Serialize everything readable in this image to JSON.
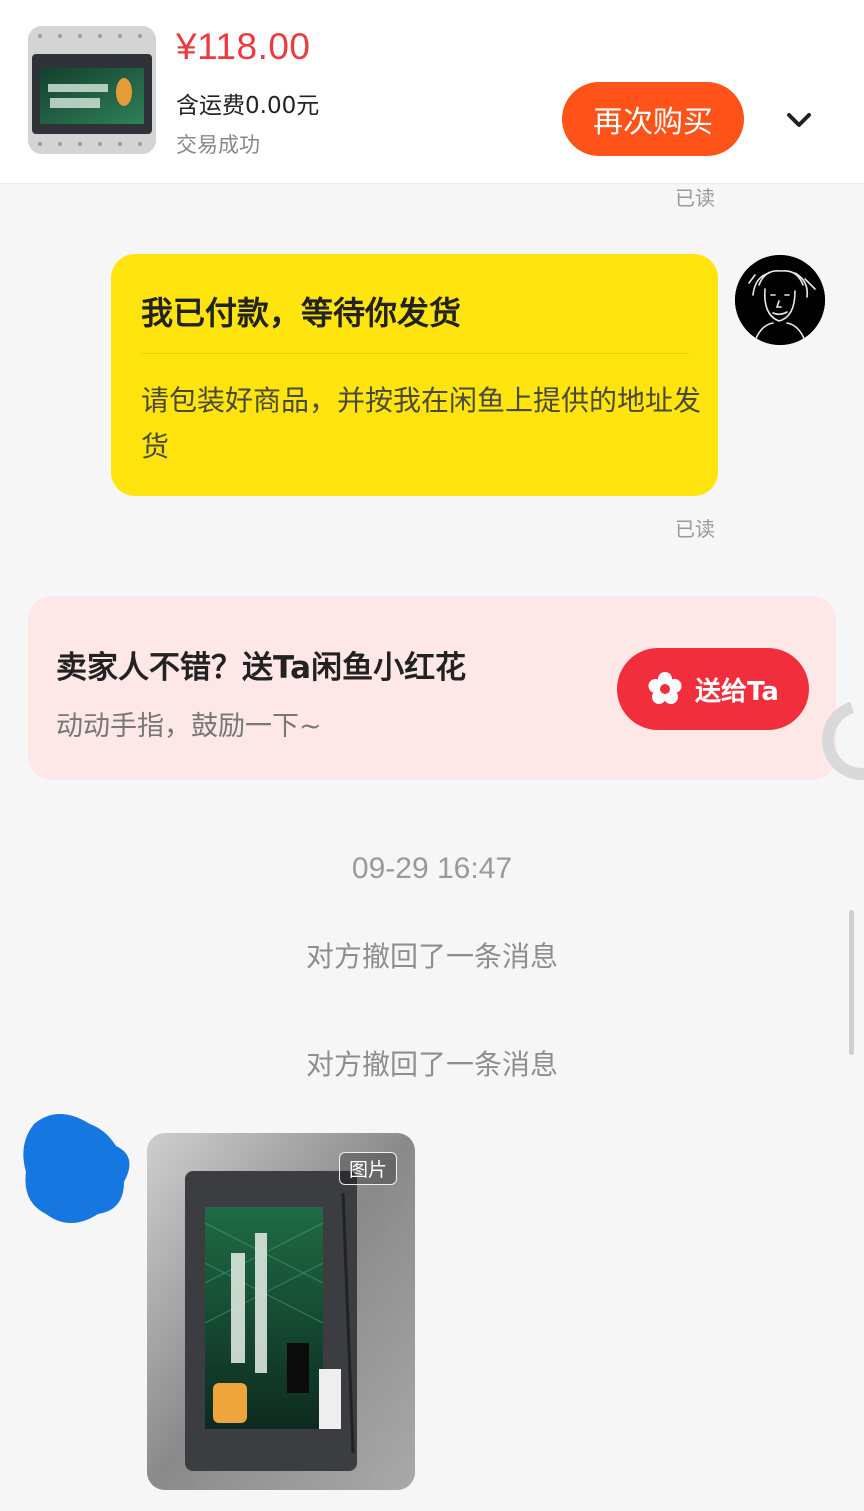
{
  "order": {
    "price": "¥118.00",
    "shipping": "含运费0.00元",
    "status": "交易成功",
    "rebuy_label": "再次购买"
  },
  "read_labels": [
    "已读",
    "已读"
  ],
  "payment_card": {
    "title": "我已付款，等待你发货",
    "description": "请包装好商品，并按我在闲鱼上提供的地址发货"
  },
  "flower_card": {
    "title": "卖家人不错？送Ta闲鱼小红花",
    "subtitle": "动动手指，鼓励一下~",
    "button_label": "送给Ta"
  },
  "timestamp": "09-29 16:47",
  "recall_messages": [
    "对方撤回了一条消息",
    "对方撤回了一条消息"
  ],
  "photo_message": {
    "tag": "图片"
  },
  "colors": {
    "price": "#ee3a3f",
    "rebuy_button": "#ff5319",
    "payment_card": "#ffe50d",
    "flower_card": "#fde8e7",
    "gift_button": "#f12e3c",
    "peer_avatar_mask": "#1677e0"
  },
  "icons": {
    "more": "chevron-down-icon",
    "gift": "flower-icon"
  }
}
